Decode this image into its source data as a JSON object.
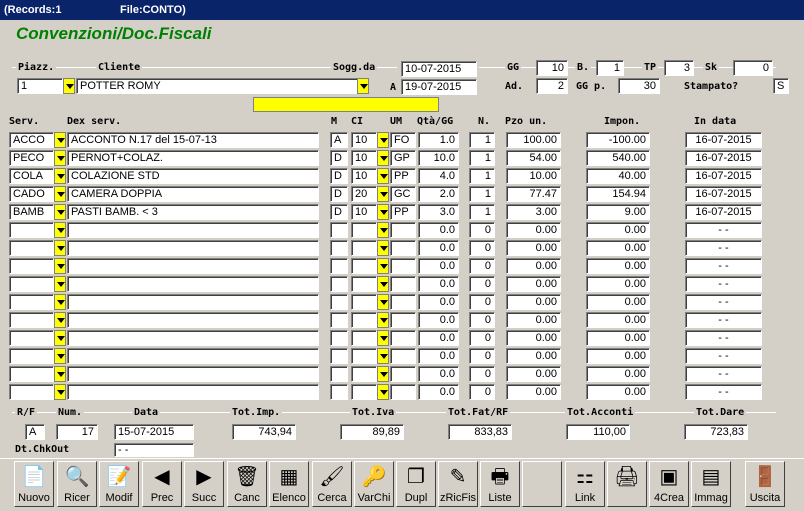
{
  "window": {
    "records": "(Records:1",
    "file": "File:CONTO)"
  },
  "heading": "Convenzioni/Doc.Fiscali",
  "header": {
    "piazz_label": "Piazz.",
    "piazz": "1",
    "cliente_label": "Cliente",
    "cliente": "POTTER ROMY",
    "sogg_label": "Sogg.da",
    "sogg_da": "10-07-2015",
    "a_label": "A",
    "sogg_a": "19-07-2015",
    "gg_label": "GG",
    "gg": "10",
    "b_label": "B.",
    "b": "1",
    "tp_label": "TP",
    "tp": "3",
    "sk_label": "Sk",
    "sk": "0",
    "ad_label": "Ad.",
    "ad": "2",
    "ggp_label": "GG p.",
    "ggp": "30",
    "stampato_label": "Stampato?",
    "stampato": "S"
  },
  "columns": {
    "serv": "Serv.",
    "dex": "Dex serv.",
    "m": "M",
    "ci": "CI",
    "um": "UM",
    "qta": "Qtà/GG",
    "n": "N.",
    "pzo": "Pzo un.",
    "impon": "Impon.",
    "indata": "In data"
  },
  "rows": [
    {
      "serv": "ACCO",
      "dex": "ACCONTO      N.17 del 15-07-13",
      "m": "A",
      "ci": "10",
      "um": "FO",
      "qta": "1.0",
      "n": "1",
      "pzo": "100.00",
      "impon": "-100.00",
      "indata": "16-07-2015"
    },
    {
      "serv": "PECO",
      "dex": "PERNOT+COLAZ.",
      "m": "D",
      "ci": "10",
      "um": "GP",
      "qta": "10.0",
      "n": "1",
      "pzo": "54.00",
      "impon": "540.00",
      "indata": "16-07-2015"
    },
    {
      "serv": "COLA",
      "dex": "COLAZIONE STD",
      "m": "D",
      "ci": "10",
      "um": "PP",
      "qta": "4.0",
      "n": "1",
      "pzo": "10.00",
      "impon": "40.00",
      "indata": "16-07-2015"
    },
    {
      "serv": "CADO",
      "dex": "CAMERA DOPPIA",
      "m": "D",
      "ci": "20",
      "um": "GC",
      "qta": "2.0",
      "n": "1",
      "pzo": "77.47",
      "impon": "154.94",
      "indata": "16-07-2015"
    },
    {
      "serv": "BAMB",
      "dex": "PASTI BAMB. < 3",
      "m": "D",
      "ci": "10",
      "um": "PP",
      "qta": "3.0",
      "n": "1",
      "pzo": "3.00",
      "impon": "9.00",
      "indata": "16-07-2015"
    },
    {
      "serv": "",
      "dex": "",
      "m": "",
      "ci": "",
      "um": "",
      "qta": "0.0",
      "n": "0",
      "pzo": "0.00",
      "impon": "0.00",
      "indata": "-   -"
    },
    {
      "serv": "",
      "dex": "",
      "m": "",
      "ci": "",
      "um": "",
      "qta": "0.0",
      "n": "0",
      "pzo": "0.00",
      "impon": "0.00",
      "indata": "-   -"
    },
    {
      "serv": "",
      "dex": "",
      "m": "",
      "ci": "",
      "um": "",
      "qta": "0.0",
      "n": "0",
      "pzo": "0.00",
      "impon": "0.00",
      "indata": "-   -"
    },
    {
      "serv": "",
      "dex": "",
      "m": "",
      "ci": "",
      "um": "",
      "qta": "0.0",
      "n": "0",
      "pzo": "0.00",
      "impon": "0.00",
      "indata": "-   -"
    },
    {
      "serv": "",
      "dex": "",
      "m": "",
      "ci": "",
      "um": "",
      "qta": "0.0",
      "n": "0",
      "pzo": "0.00",
      "impon": "0.00",
      "indata": "-   -"
    },
    {
      "serv": "",
      "dex": "",
      "m": "",
      "ci": "",
      "um": "",
      "qta": "0.0",
      "n": "0",
      "pzo": "0.00",
      "impon": "0.00",
      "indata": "-   -"
    },
    {
      "serv": "",
      "dex": "",
      "m": "",
      "ci": "",
      "um": "",
      "qta": "0.0",
      "n": "0",
      "pzo": "0.00",
      "impon": "0.00",
      "indata": "-   -"
    },
    {
      "serv": "",
      "dex": "",
      "m": "",
      "ci": "",
      "um": "",
      "qta": "0.0",
      "n": "0",
      "pzo": "0.00",
      "impon": "0.00",
      "indata": "-   -"
    },
    {
      "serv": "",
      "dex": "",
      "m": "",
      "ci": "",
      "um": "",
      "qta": "0.0",
      "n": "0",
      "pzo": "0.00",
      "impon": "0.00",
      "indata": "-   -"
    },
    {
      "serv": "",
      "dex": "",
      "m": "",
      "ci": "",
      "um": "",
      "qta": "0.0",
      "n": "0",
      "pzo": "0.00",
      "impon": "0.00",
      "indata": "-   -"
    }
  ],
  "footer": {
    "rf_label": "R/F",
    "rf": "A",
    "num_label": "Num.",
    "num": "17",
    "data_label": "Data",
    "data": "15-07-2015",
    "chkout_label": "Dt.ChkOut",
    "chkout": "-   -",
    "tot_imp_label": "Tot.Imp.",
    "tot_imp": "743,94",
    "tot_iva_label": "Tot.Iva",
    "tot_iva": "89,89",
    "tot_fat_label": "Tot.Fat/RF",
    "tot_fat": "833,83",
    "tot_acconti_label": "Tot.Acconti",
    "tot_acconti": "110,00",
    "tot_dare_label": "Tot.Dare",
    "tot_dare": "723,83"
  },
  "toolbar": [
    {
      "id": "nuovo",
      "label": "Nuovo",
      "icon": "new-doc-icon",
      "glyph": "📄"
    },
    {
      "id": "ricer",
      "label": "Ricer",
      "icon": "search-icon",
      "glyph": "🔍"
    },
    {
      "id": "modif",
      "label": "Modif",
      "icon": "edit-icon",
      "glyph": "📝"
    },
    {
      "id": "prec",
      "label": "Prec",
      "icon": "arrow-left-icon",
      "glyph": "◀"
    },
    {
      "id": "succ",
      "label": "Succ",
      "icon": "arrow-right-icon",
      "glyph": "▶"
    },
    {
      "id": "canc",
      "label": "Canc",
      "icon": "trash-icon",
      "glyph": "🗑"
    },
    {
      "id": "elenco",
      "label": "Elenco",
      "icon": "list-icon",
      "glyph": "▦"
    },
    {
      "id": "cerca",
      "label": "Cerca",
      "icon": "brush-icon",
      "glyph": "🖌"
    },
    {
      "id": "varchi",
      "label": "VarChi",
      "icon": "keys-icon",
      "glyph": "🔑"
    },
    {
      "id": "dupl",
      "label": "Dupl",
      "icon": "duplicate-icon",
      "glyph": "❐"
    },
    {
      "id": "zricfis",
      "label": "zRicFis",
      "icon": "fiscal-receipt-icon",
      "glyph": "✎"
    },
    {
      "id": "liste",
      "label": "Liste",
      "icon": "printer-list-icon",
      "glyph": "🖶"
    },
    {
      "id": "blank",
      "label": "",
      "icon": "blank-icon",
      "glyph": ""
    },
    {
      "id": "link",
      "label": "Link",
      "icon": "network-icon",
      "glyph": "⚏"
    },
    {
      "id": "print",
      "label": "",
      "icon": "printer-icon",
      "glyph": "🖨"
    },
    {
      "id": "4crea",
      "label": "4Crea",
      "icon": "create-image-icon",
      "glyph": "▣"
    },
    {
      "id": "immag",
      "label": "Immag",
      "icon": "id-card-icon",
      "glyph": "▤"
    },
    {
      "id": "blank2",
      "label": "",
      "icon": "blank-icon",
      "glyph": ""
    },
    {
      "id": "uscita",
      "label": "Uscita",
      "icon": "exit-door-icon",
      "glyph": "🚪"
    }
  ]
}
